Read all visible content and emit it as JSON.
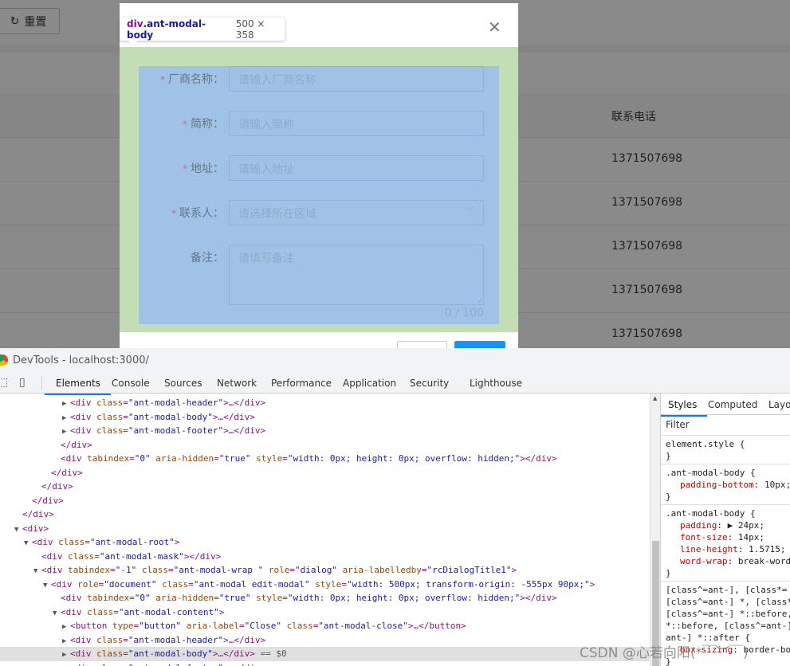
{
  "page": {
    "reset_label": "重置",
    "reset_icon": "reload-icon",
    "table": {
      "header_phone": "联系电话",
      "rows": [
        "1371507698",
        "1371507698",
        "1371507698",
        "1371507698",
        "1371507698"
      ]
    }
  },
  "modal": {
    "close_icon": "close-icon",
    "fields": [
      {
        "label": "厂商名称：",
        "required": true,
        "placeholder": "请输入厂商名称"
      },
      {
        "label": "简称：",
        "required": true,
        "placeholder": "请输入简称"
      },
      {
        "label": "地址：",
        "required": true,
        "placeholder": "请输入地址"
      },
      {
        "label": "联系人：",
        "required": true,
        "placeholder": "请选择所在区域"
      },
      {
        "label": "备注：",
        "required": false,
        "placeholder": "请填写备注"
      }
    ],
    "required_mark": "*",
    "counter": "0 / 100",
    "primary_color": "#1890ff"
  },
  "inspect_tooltip": {
    "name_tag": "div",
    "name_class": ".ant-modal-body",
    "size": "500 × 358"
  },
  "devtools": {
    "title": "DevTools - localhost:3000/",
    "tabs": [
      "Elements",
      "Console",
      "Sources",
      "Network",
      "Performance",
      "Application",
      "Security",
      "Lighthouse"
    ],
    "active_tab": "Elements",
    "lines": [
      {
        "toggle": "▶",
        "text": "<div class=\"ant-modal-header\">…</div>"
      },
      {
        "toggle": "▶",
        "text": "<div class=\"ant-modal-body\">…</div>"
      },
      {
        "toggle": "▶",
        "text": "<div class=\"ant-modal-footer\">…</div>"
      },
      {
        "toggle": "",
        "text": "</div>"
      },
      {
        "toggle": "",
        "text": "<div tabindex=\"0\" aria-hidden=\"true\" style=\"width: 0px; height: 0px; overflow: hidden;\"></div>"
      },
      {
        "toggle": "",
        "text": "</div>"
      },
      {
        "toggle": "",
        "text": "</div>"
      },
      {
        "toggle": "",
        "text": "</div>"
      },
      {
        "toggle": "",
        "text": "</div>"
      },
      {
        "toggle": "▼",
        "text": "<div>"
      },
      {
        "toggle": "▼",
        "text": "<div class=\"ant-modal-root\">"
      },
      {
        "toggle": "",
        "text": "<div class=\"ant-modal-mask\"></div>"
      },
      {
        "toggle": "▼",
        "text": "<div tabindex=\"-1\" class=\"ant-modal-wrap \" role=\"dialog\" aria-labelledby=\"rcDialogTitle1\">"
      },
      {
        "toggle": "▼",
        "text": "<div role=\"document\" class=\"ant-modal edit-modal\" style=\"width: 500px; transform-origin: -555px 90px;\">"
      },
      {
        "toggle": "",
        "text": "<div tabindex=\"0\" aria-hidden=\"true\" style=\"width: 0px; height: 0px; overflow: hidden;\"></div>"
      },
      {
        "toggle": "▼",
        "text": "<div class=\"ant-modal-content\">"
      },
      {
        "toggle": "▶",
        "text": "<button type=\"button\" aria-label=\"Close\" class=\"ant-modal-close\">…</button>"
      },
      {
        "toggle": "▶",
        "text": "<div class=\"ant-modal-header\">…</div>"
      },
      {
        "toggle": "▶",
        "text": "<div class=\"ant-modal-body\">…</div>",
        "suffix": " == $0",
        "selected": true
      },
      {
        "toggle": "▶",
        "text": "<div class=\"ant-modal-footer\">…</div>"
      }
    ],
    "styles": {
      "tabs": [
        "Styles",
        "Computed",
        "Layout"
      ],
      "filter_placeholder": "Filter",
      "rules": [
        {
          "selector": "element.style {",
          "props": []
        },
        {
          "selector": ".ant-modal-body {",
          "props": [
            [
              "padding-bottom",
              "10px;"
            ]
          ]
        },
        {
          "selector": ".ant-modal-body {",
          "props": [
            [
              "padding",
              "▶ 24px;"
            ],
            [
              "font-size",
              "14px;"
            ],
            [
              "line-height",
              "1.5715;"
            ],
            [
              "word-wrap",
              "break-word"
            ]
          ]
        },
        {
          "selector": "[class^=ant-], [class*=\n[class^=ant-] *, [class*\n[class^=ant-] *::before,\n*::before, [class^=ant-]\nant-] *::after {",
          "props": [
            [
              "box-sizing",
              "border-bo"
            ]
          ]
        }
      ]
    }
  },
  "watermark": "CSDN @心若向阳(*￣︶￣)"
}
